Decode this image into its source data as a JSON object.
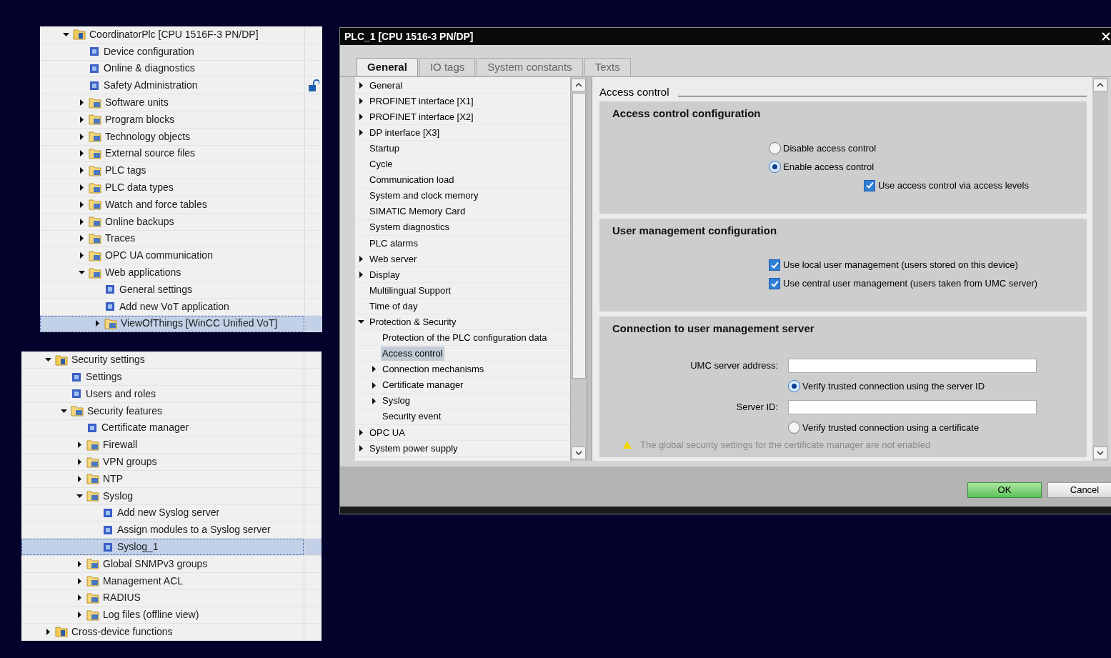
{
  "project_tree": {
    "items": [
      {
        "label": "CoordinatorPlc [CPU 1516F-3 PN/DP]",
        "expanded": true,
        "selected": false,
        "children": [
          {
            "label": "Device configuration",
            "selected": false
          },
          {
            "label": "Online & diagnostics",
            "selected": false
          },
          {
            "label": "Safety Administration",
            "selected": false,
            "locked": false
          },
          {
            "label": "Software units",
            "expanded": false,
            "selected": false
          },
          {
            "label": "Program blocks",
            "expanded": false,
            "selected": false
          },
          {
            "label": "Technology objects",
            "expanded": false,
            "selected": false
          },
          {
            "label": "External source files",
            "expanded": false,
            "selected": false
          },
          {
            "label": "PLC tags",
            "expanded": false,
            "selected": false
          },
          {
            "label": "PLC data types",
            "expanded": false,
            "selected": false
          },
          {
            "label": "Watch and force tables",
            "expanded": false,
            "selected": false
          },
          {
            "label": "Online backups",
            "expanded": false,
            "selected": false
          },
          {
            "label": "Traces",
            "expanded": false,
            "selected": false
          },
          {
            "label": "OPC UA communication",
            "expanded": false,
            "selected": false
          },
          {
            "label": "Web applications",
            "expanded": true,
            "selected": false,
            "children": [
              {
                "label": "General settings",
                "selected": false
              },
              {
                "label": "Add new VoT application",
                "selected": false
              },
              {
                "label": "ViewOfThings [WinCC Unified VoT]",
                "expanded": false,
                "selected": true
              }
            ]
          }
        ]
      }
    ]
  },
  "security_tree": {
    "items": [
      {
        "label": "Security settings",
        "expanded": true,
        "selected": false,
        "children": [
          {
            "label": "Settings",
            "selected": false
          },
          {
            "label": "Users and roles",
            "selected": false
          },
          {
            "label": "Security features",
            "expanded": true,
            "selected": false,
            "children": [
              {
                "label": "Certificate manager",
                "selected": false
              },
              {
                "label": "Firewall",
                "expanded": false,
                "selected": false
              },
              {
                "label": "VPN groups",
                "expanded": false,
                "selected": false
              },
              {
                "label": "NTP",
                "expanded": false,
                "selected": false
              },
              {
                "label": "Syslog",
                "expanded": true,
                "selected": false,
                "children": [
                  {
                    "label": "Add new Syslog server",
                    "selected": false
                  },
                  {
                    "label": "Assign modules to a Syslog server",
                    "selected": false
                  },
                  {
                    "label": "Syslog_1",
                    "selected": true
                  }
                ]
              },
              {
                "label": "Global SNMPv3 groups",
                "expanded": false,
                "selected": false
              },
              {
                "label": "Management ACL",
                "expanded": false,
                "selected": false
              },
              {
                "label": "RADIUS",
                "expanded": false,
                "selected": false
              },
              {
                "label": "Log files (offline view)",
                "expanded": false,
                "selected": false
              }
            ]
          }
        ]
      },
      {
        "label": "Cross-device functions",
        "expanded": false,
        "selected": false
      }
    ]
  },
  "dialog": {
    "title": "PLC_1 [CPU 1516-3 PN/DP]",
    "tabs": [
      {
        "label": "General",
        "selected": true
      },
      {
        "label": "IO tags",
        "selected": false
      },
      {
        "label": "System constants",
        "selected": false
      },
      {
        "label": "Texts",
        "selected": false
      }
    ],
    "nav": {
      "items": [
        {
          "label": "General",
          "expanded": false,
          "selected": false
        },
        {
          "label": "PROFINET interface [X1]",
          "expanded": false,
          "selected": false
        },
        {
          "label": "PROFINET interface [X2]",
          "expanded": false,
          "selected": false
        },
        {
          "label": "DP interface [X3]",
          "expanded": false,
          "selected": false
        },
        {
          "label": "Startup",
          "selected": false
        },
        {
          "label": "Cycle",
          "selected": false
        },
        {
          "label": "Communication load",
          "selected": false
        },
        {
          "label": "System and clock memory",
          "selected": false
        },
        {
          "label": "SIMATIC Memory Card",
          "selected": false
        },
        {
          "label": "System diagnostics",
          "selected": false
        },
        {
          "label": "PLC alarms",
          "selected": false
        },
        {
          "label": "Web server",
          "expanded": false,
          "selected": false
        },
        {
          "label": "Display",
          "expanded": false,
          "selected": false
        },
        {
          "label": "Multilingual Support",
          "selected": false
        },
        {
          "label": "Time of day",
          "selected": false
        },
        {
          "label": "Protection & Security",
          "expanded": true,
          "selected": false,
          "children": [
            {
              "label": "Protection of the PLC configuration data",
              "selected": false
            },
            {
              "label": "Access control",
              "selected": true
            },
            {
              "label": "Connection mechanisms",
              "expanded": false,
              "selected": false
            },
            {
              "label": "Certificate manager",
              "expanded": false,
              "selected": false
            },
            {
              "label": "Syslog",
              "expanded": false,
              "selected": false
            },
            {
              "label": "Security event",
              "selected": false
            }
          ]
        },
        {
          "label": "OPC UA",
          "expanded": false,
          "selected": false
        },
        {
          "label": "System power supply",
          "expanded": false,
          "selected": false
        }
      ]
    },
    "content": {
      "heading": "Access control",
      "sections": [
        {
          "title": "Access control configuration",
          "items": [
            {
              "kind": "radio",
              "label": "Disable access control",
              "selected": false
            },
            {
              "kind": "radio",
              "label": "Enable access control",
              "selected": true,
              "children": [
                {
                  "kind": "checkbox",
                  "label": "Use access control via access levels",
                  "checked": true
                }
              ]
            }
          ]
        },
        {
          "title": "User management configuration",
          "items": [
            {
              "kind": "checkbox",
              "label": "Use local user management (users stored on this device)",
              "checked": true
            },
            {
              "kind": "checkbox",
              "label": "Use central user management (users taken from UMC server)",
              "checked": true
            }
          ]
        },
        {
          "title": "Connection to user management server",
          "items": [
            {
              "kind": "field",
              "label": "UMC server address:"
            },
            {
              "kind": "radio",
              "label": "Verify trusted connection using the server ID",
              "selected": true
            },
            {
              "kind": "field",
              "label": "Server ID:"
            },
            {
              "kind": "radio",
              "label": "Verify trusted connection using a certificate",
              "selected": false
            },
            {
              "kind": "warning",
              "label": "The global security settings for the certificate manager are not enabled"
            }
          ]
        }
      ]
    },
    "buttons": [
      {
        "label": "OK",
        "kind": "primary"
      },
      {
        "label": "Cancel",
        "kind": "secondary"
      }
    ]
  }
}
